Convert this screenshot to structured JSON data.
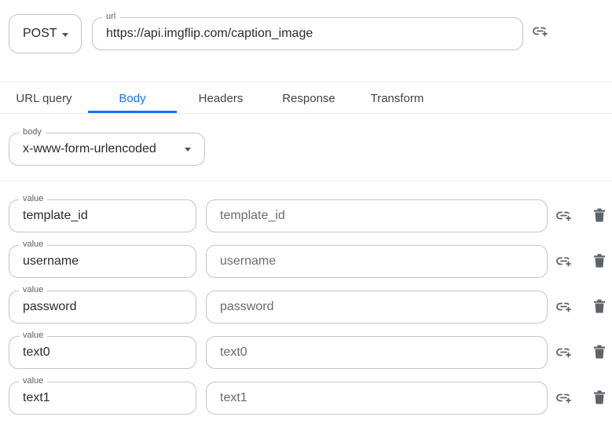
{
  "request": {
    "method": "POST",
    "url_label": "url",
    "url": "https://api.imgflip.com/caption_image"
  },
  "tabs": [
    {
      "label": "URL query"
    },
    {
      "label": "Body"
    },
    {
      "label": "Headers"
    },
    {
      "label": "Response"
    },
    {
      "label": "Transform"
    }
  ],
  "active_tab": "Body",
  "body": {
    "label": "body",
    "type": "x-www-form-urlencoded"
  },
  "params": [
    {
      "key_label": "value",
      "key": "template_id",
      "value": "template_id"
    },
    {
      "key_label": "value",
      "key": "username",
      "value": "username"
    },
    {
      "key_label": "value",
      "key": "password",
      "value": "password"
    },
    {
      "key_label": "value",
      "key": "text0",
      "value": "text0"
    },
    {
      "key_label": "value",
      "key": "text1",
      "value": "text1"
    }
  ],
  "icons": {
    "link": "add-link-icon",
    "delete": "trash-icon"
  },
  "colors": {
    "accent": "#1a73e8",
    "border": "#c4c4c4",
    "icon": "#5f6368"
  }
}
